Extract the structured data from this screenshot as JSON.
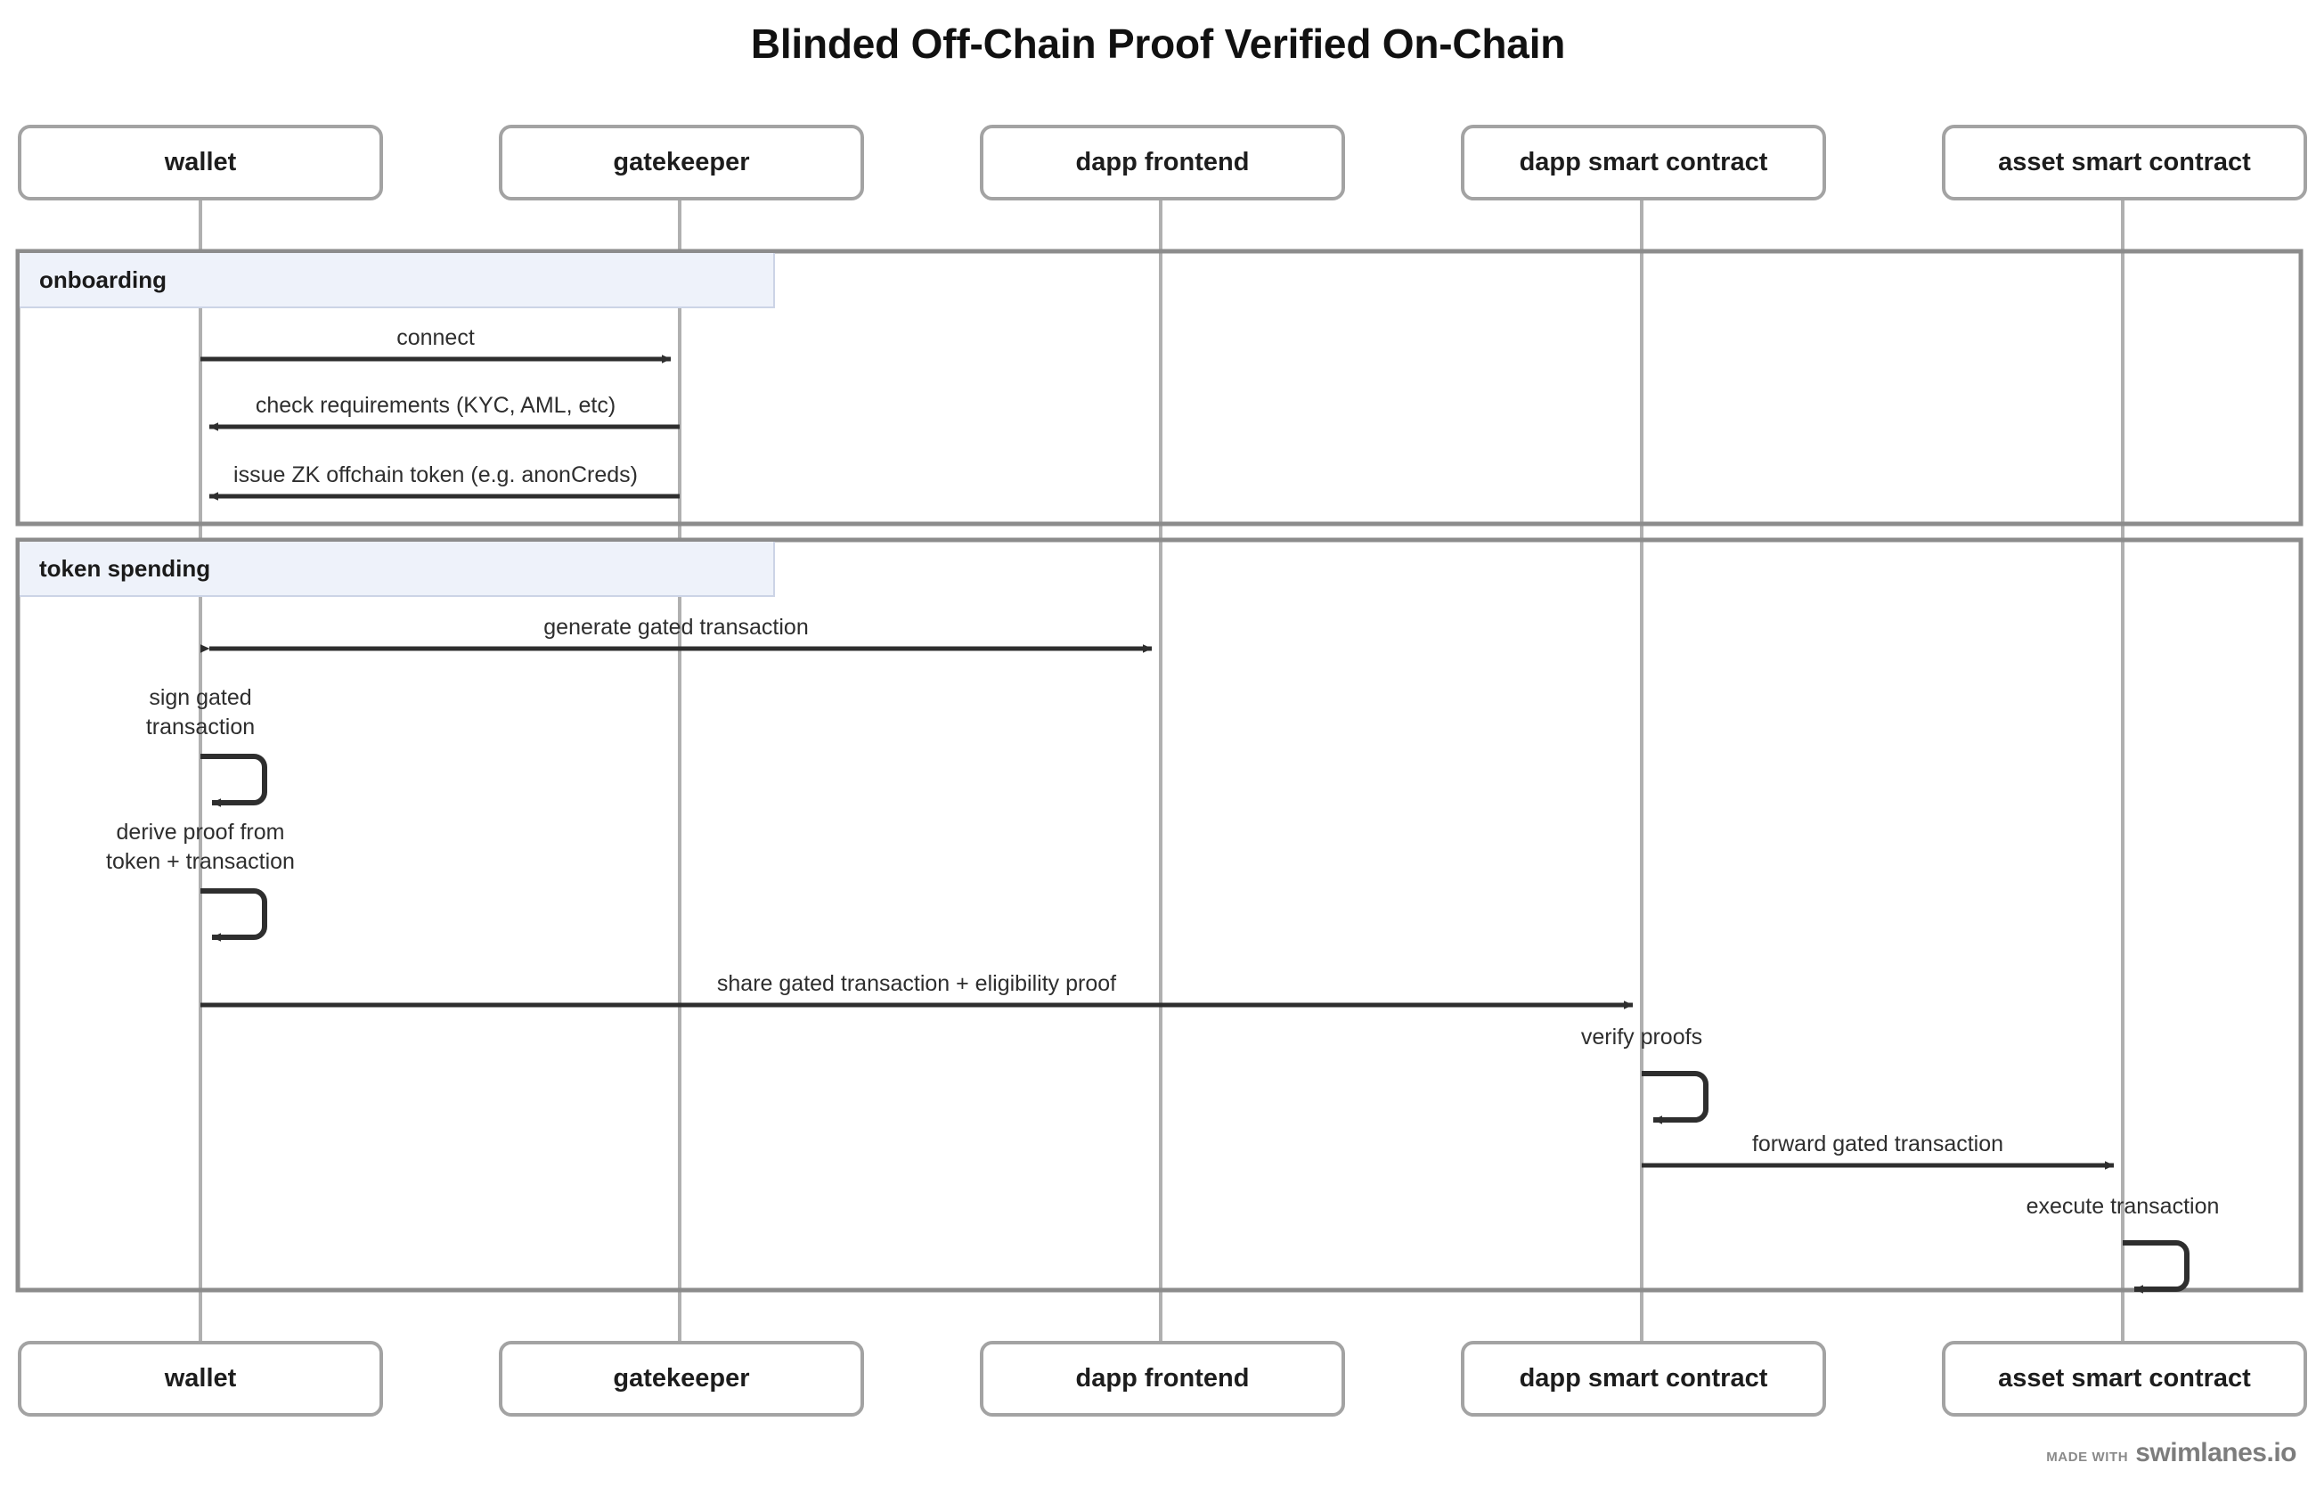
{
  "title": "Blinded Off-Chain Proof Verified On-Chain",
  "colors": {
    "participant_border": "#a3a3a3",
    "lifeline": "#b0b0b0",
    "fragment_border": "#8c8c8c",
    "fragment_label_fill": "#eef2fa",
    "arrow": "#2e2e2e",
    "text": "#2e2e2e",
    "title": "#111111"
  },
  "participants": [
    {
      "id": "wallet",
      "label": "wallet"
    },
    {
      "id": "gatekeeper",
      "label": "gatekeeper"
    },
    {
      "id": "dapp-frontend",
      "label": "dapp frontend"
    },
    {
      "id": "dapp-smart-contract",
      "label": "dapp smart contract"
    },
    {
      "id": "asset-smart-contract",
      "label": "asset smart contract"
    }
  ],
  "fragments": [
    {
      "id": "onboarding",
      "label": "onboarding"
    },
    {
      "id": "token-spending",
      "label": "token spending"
    }
  ],
  "messages": [
    {
      "id": "connect",
      "label": "connect",
      "from": "wallet",
      "to": "gatekeeper",
      "direction": "forward"
    },
    {
      "id": "check-requirements",
      "label": "check requirements (KYC, AML, etc)",
      "from": "gatekeeper",
      "to": "wallet",
      "direction": "backward"
    },
    {
      "id": "issue-zk-token",
      "label": "issue ZK offchain token (e.g. anonCreds)",
      "from": "gatekeeper",
      "to": "wallet",
      "direction": "backward"
    },
    {
      "id": "generate-gated-transaction",
      "label": "generate gated transaction",
      "from": "wallet",
      "to": "dapp-frontend",
      "direction": "bidirectional"
    },
    {
      "id": "sign-gated-transaction",
      "label": "sign gated\ntransaction",
      "from": "wallet",
      "to": "wallet",
      "direction": "self"
    },
    {
      "id": "derive-proof",
      "label": "derive proof from\ntoken + transaction",
      "from": "wallet",
      "to": "wallet",
      "direction": "self"
    },
    {
      "id": "share-gated-transaction",
      "label": "share gated transaction + eligibility proof",
      "from": "wallet",
      "to": "dapp-smart-contract",
      "direction": "forward"
    },
    {
      "id": "verify-proofs",
      "label": "verify proofs",
      "from": "dapp-smart-contract",
      "to": "dapp-smart-contract",
      "direction": "self"
    },
    {
      "id": "forward-gated-transaction",
      "label": "forward gated transaction",
      "from": "dapp-smart-contract",
      "to": "asset-smart-contract",
      "direction": "forward"
    },
    {
      "id": "execute-transaction",
      "label": "execute transaction",
      "from": "asset-smart-contract",
      "to": "asset-smart-contract",
      "direction": "self"
    }
  ],
  "message_labels": {
    "connect": "connect",
    "check_requirements": "check requirements (KYC, AML, etc)",
    "issue_zk_token": "issue ZK offchain token (e.g. anonCreds)",
    "generate_gated_transaction": "generate gated transaction",
    "sign_gated_transaction_line1": "sign gated",
    "sign_gated_transaction_line2": "transaction",
    "derive_proof_line1": "derive proof from",
    "derive_proof_line2": "token + transaction",
    "share_gated_transaction": "share gated transaction + eligibility proof",
    "verify_proofs": "verify proofs",
    "forward_gated_transaction": "forward gated transaction",
    "execute_transaction": "execute transaction"
  },
  "footer": {
    "made_with": "MADE WITH",
    "brand": "swimlanes.io"
  }
}
